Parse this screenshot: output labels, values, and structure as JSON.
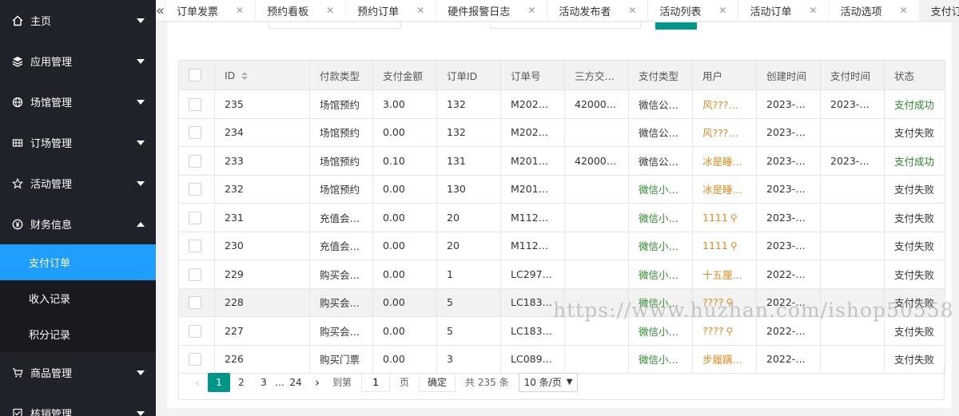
{
  "sidebar": {
    "items": [
      {
        "label": "主页",
        "icon": "home-icon"
      },
      {
        "label": "应用管理",
        "icon": "layers-icon"
      },
      {
        "label": "场馆管理",
        "icon": "globe-icon"
      },
      {
        "label": "订场管理",
        "icon": "grid-icon"
      },
      {
        "label": "活动管理",
        "icon": "star-icon"
      },
      {
        "label": "财务信息",
        "icon": "yen-icon",
        "expanded": true
      }
    ],
    "finance_sub": [
      {
        "label": "支付订单",
        "active": true
      },
      {
        "label": "收入记录"
      },
      {
        "label": "积分记录"
      }
    ],
    "items_after": [
      {
        "label": "商品管理",
        "icon": "cart-icon"
      },
      {
        "label": "核销管理",
        "icon": "checklist-icon"
      }
    ]
  },
  "tabs": [
    {
      "label": "订单发票"
    },
    {
      "label": "预约看板"
    },
    {
      "label": "预约订单"
    },
    {
      "label": "硬件报警日志"
    },
    {
      "label": "活动发布者"
    },
    {
      "label": "活动列表"
    },
    {
      "label": "活动订单"
    },
    {
      "label": "活动选项"
    },
    {
      "label": "支付订单",
      "active": true
    }
  ],
  "table": {
    "headers": [
      "ID",
      "付款类型",
      "支付金额",
      "订单ID",
      "订单号",
      "三方交…",
      "支付类型",
      "用户",
      "创建时间",
      "支付时间",
      "状态"
    ],
    "rows": [
      [
        "235",
        "场馆预约",
        "3.00",
        "132",
        "M2024…",
        "42000…",
        "微信公…",
        "风???…",
        "2023-…",
        "2023-…",
        "支付成功"
      ],
      [
        "234",
        "场馆预约",
        "0.00",
        "132",
        "M2024…",
        "",
        "微信公…",
        "风???…",
        "2023-…",
        "",
        "支付失败"
      ],
      [
        "233",
        "场馆预约",
        "0.10",
        "131",
        "M2013…",
        "42000…",
        "微信公…",
        "冰是睡…",
        "2023-…",
        "2023-…",
        "支付成功"
      ],
      [
        "232",
        "场馆预约",
        "0.00",
        "130",
        "M2013…",
        "",
        "微信小…",
        "冰是睡…",
        "2023-…",
        "",
        "支付失败"
      ],
      [
        "231",
        "充值会…",
        "0.00",
        "20",
        "M1121…",
        "",
        "微信小…",
        "1111",
        "2023-…",
        "",
        "支付失败"
      ],
      [
        "230",
        "充值会…",
        "0.00",
        "20",
        "M1121…",
        "",
        "微信小…",
        "1111",
        "2023-…",
        "",
        "支付失败"
      ],
      [
        "229",
        "购买会…",
        "0.00",
        "1",
        "LC297…",
        "",
        "微信小…",
        "十五厘…",
        "2022-…",
        "",
        "支付失败"
      ],
      [
        "228",
        "购买会…",
        "0.00",
        "5",
        "LC183…",
        "",
        "微信小…",
        "????",
        "2022-…",
        "",
        "支付失败"
      ],
      [
        "227",
        "购买会…",
        "0.00",
        "5",
        "LC183…",
        "",
        "微信小…",
        "????",
        "2022-…",
        "",
        "支付失败"
      ],
      [
        "226",
        "购买门票",
        "0.00",
        "3",
        "LC089…",
        "",
        "微信小…",
        "步履蹒…",
        "2022-…",
        "",
        "支付失败"
      ]
    ],
    "pay_type_green_rows": [
      3,
      4,
      5,
      6,
      7,
      8,
      9
    ],
    "user_search_rows": [
      4,
      5,
      7,
      8
    ],
    "status_success_color": "#2a8a2a",
    "user_color": "#e5891e"
  },
  "pagination": {
    "pages": [
      "1",
      "2",
      "3",
      "…",
      "24"
    ],
    "current": "1",
    "goto_label": "到第",
    "goto_value": "1",
    "page_unit": "页",
    "confirm": "确定",
    "total": "共 235 条",
    "page_size": "10 条/页"
  },
  "watermark": "https://www.huzhan.com/ishop50558"
}
